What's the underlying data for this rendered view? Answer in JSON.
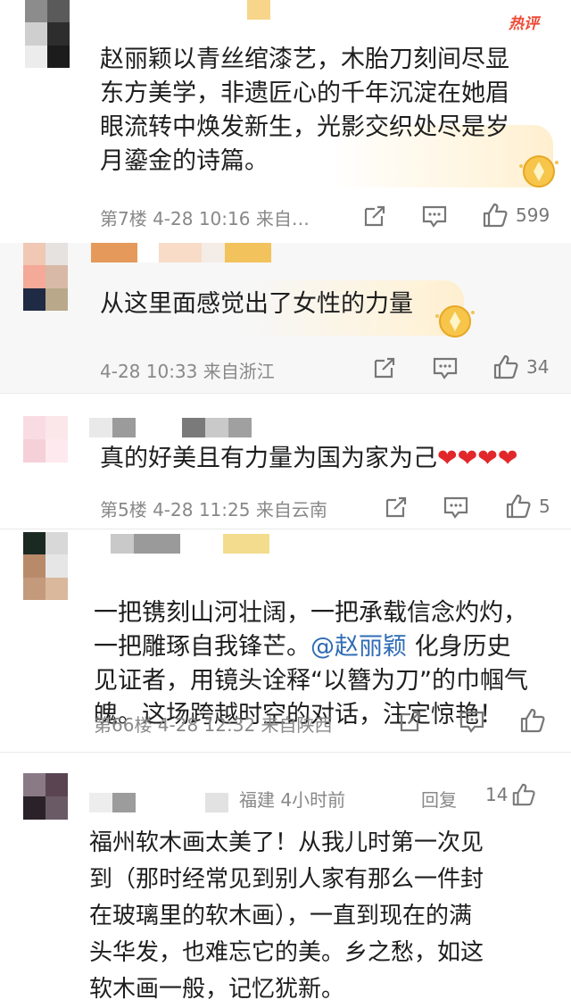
{
  "hot_badge": "热评",
  "comments": [
    {
      "text": "赵丽颖以青丝绾漆艺，木胎刀刻间尽显\n东方美学，非遗匠心的千年沉淀在她眉\n眼流转中焕发新生，光影交织处尽是岁\n月鎏金的诗篇。",
      "meta": "第7楼  4-28 10:16  来自…",
      "likes": "599"
    },
    {
      "text": "从这里面感觉出了女性的力量",
      "meta": "4-28 10:33  来自浙江",
      "likes": "34"
    },
    {
      "text": "真的好美且有力量为国为家为己",
      "hearts": "❤❤❤❤",
      "meta": "第5楼  4-28 11:25  来自云南",
      "likes": "5"
    },
    {
      "text_before": "一把镌刻山河壮阔，一把承载信念灼灼，\n一把雕琢自我锋芒。",
      "mention": "@赵丽颖",
      "text_after": " 化身历史\n见证者，用镜头诠释“以簪为刀”的巾帼气\n魄。这场跨越时空的对话，注定惊艳！",
      "meta": "第66楼  4-28 12:32  来自陕西",
      "likes": ""
    },
    {
      "location_time": "福建  4小时前",
      "reply_label": "回复",
      "likes": "14",
      "text": "福州软木画太美了！从我儿时第一次见\n到（那时经常见到别人家有那么一件封\n在玻璃里的软木画），一直到现在的满\n头华发，也难忘它的美。乡之愁，如这\n软木画一般，记忆犹新。"
    }
  ],
  "colors": {
    "accent_red": "#f04a36",
    "mention_blue": "#2f6cb5",
    "meta_gray": "#888888"
  }
}
